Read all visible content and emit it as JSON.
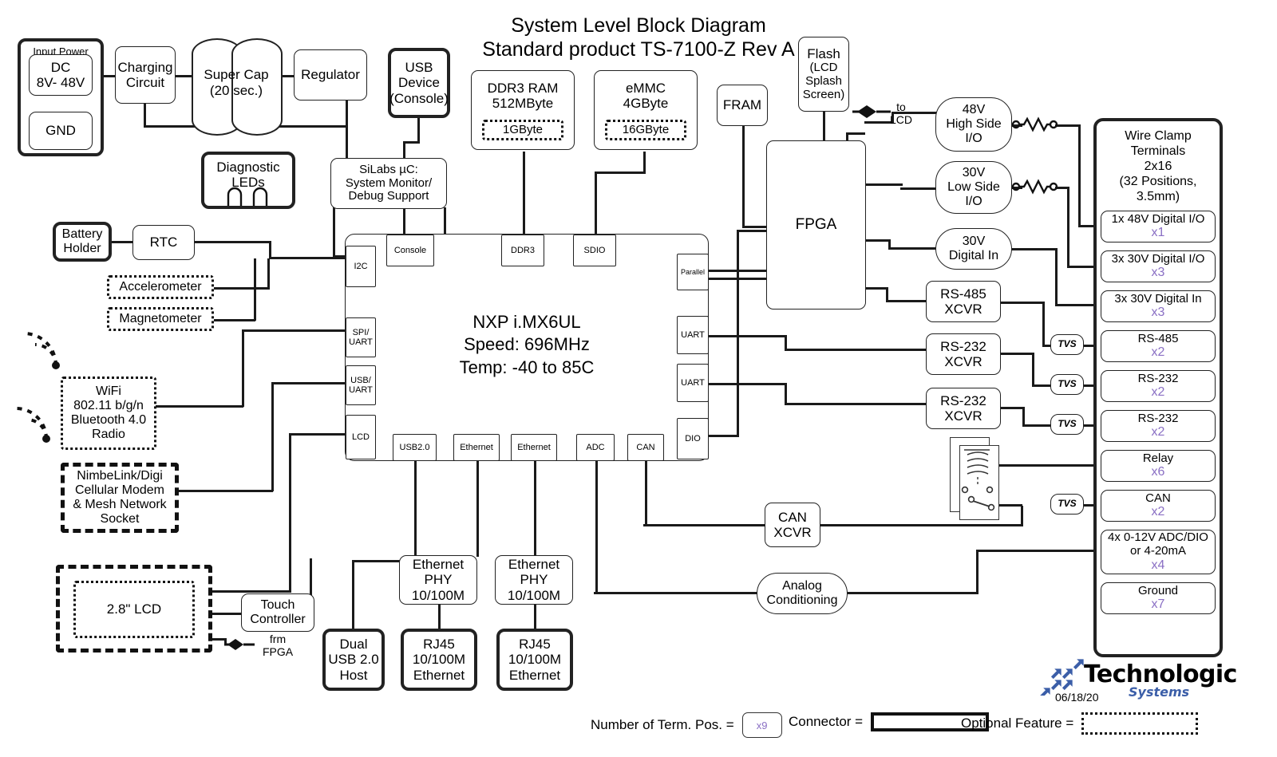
{
  "title": {
    "line1": "System Level Block Diagram",
    "line2": "Standard product TS-7100-Z Rev A"
  },
  "power": {
    "group_label": "Input Power",
    "dc": "DC\n8V- 48V",
    "dc_l1": "DC",
    "dc_l2": "8V- 48V",
    "gnd": "GND",
    "charging": "Charging\nCircuit",
    "charging_l1": "Charging",
    "charging_l2": "Circuit",
    "supercap_l1": "Super Cap",
    "supercap_l2": "(20 sec.)",
    "regulator": "Regulator"
  },
  "usb_device": {
    "l1": "USB",
    "l2": "Device",
    "l3": "(Console)"
  },
  "memory": {
    "ddr3_l1": "DDR3 RAM",
    "ddr3_l2": "512MByte",
    "ddr3_option": "1GByte",
    "emmc_l1": "eMMC",
    "emmc_l2": "4GByte",
    "emmc_option": "16GByte",
    "fram": "FRAM"
  },
  "flash": {
    "l1": "Flash",
    "l2": "(LCD",
    "l3": "Splash",
    "l4": "Screen)"
  },
  "fpga": {
    "label": "FPGA",
    "to_lcd_l1": "to",
    "to_lcd_l2": "LCD"
  },
  "silabs": {
    "l1": "SiLabs µC:",
    "l2": "System Monitor/",
    "l3": "Debug Support"
  },
  "diagnostic_leds": {
    "l1": "Diagnostic",
    "l2": "LEDs"
  },
  "left_peripherals": {
    "battery_l1": "Battery",
    "battery_l2": "Holder",
    "rtc": "RTC",
    "accelerometer": "Accelerometer",
    "magnetometer": "Magnetometer",
    "wifi_l1": "WiFi",
    "wifi_l2": "802.11 b/g/n",
    "wifi_l3": "Bluetooth 4.0",
    "wifi_l4": "Radio",
    "modem_l1": "NimbeLink/Digi",
    "modem_l2": "Cellular Modem",
    "modem_l3": "& Mesh Network",
    "modem_l4": "Socket",
    "lcd": "2.8\" LCD",
    "touch_l1": "Touch",
    "touch_l2": "Controller",
    "frm_fpga_l1": "frm",
    "frm_fpga_l2": "FPGA"
  },
  "cpu": {
    "name": "NXP i.MX6UL",
    "speed": "Speed: 696MHz",
    "temp": "Temp: -40 to 85C",
    "ports_top": [
      "Console",
      "DDR3",
      "SDIO"
    ],
    "ports_left": [
      "I2C",
      "SPI/\nUART",
      "USB/\nUART",
      "LCD"
    ],
    "ports_left_flat": [
      "I2C",
      "SPI/ UART",
      "USB/ UART",
      "LCD"
    ],
    "ports_right": [
      "Parallel",
      "UART",
      "UART",
      "DIO"
    ],
    "ports_bottom": [
      "USB2.0",
      "Ethernet",
      "Ethernet",
      "ADC",
      "CAN"
    ]
  },
  "bottom_blocks": {
    "eth_phy_l1": "Ethernet",
    "eth_phy_l2": "PHY",
    "eth_phy_l3": "10/100M",
    "rj45_l1": "RJ45",
    "rj45_l2": "10/100M",
    "rj45_l3": "Ethernet",
    "usb_host_l1": "Dual",
    "usb_host_l2": "USB 2.0",
    "usb_host_l3": "Host",
    "can_xcvr_l1": "CAN",
    "can_xcvr_l2": "XCVR",
    "analog_l1": "Analog",
    "analog_l2": "Conditioning"
  },
  "io_column": [
    {
      "l1": "48V",
      "l2": "High Side",
      "l3": "I/O",
      "shape": "pill"
    },
    {
      "l1": "30V",
      "l2": "Low Side",
      "l3": "I/O",
      "shape": "pill"
    },
    {
      "l1": "30V",
      "l2": "Digital In",
      "l3": "",
      "shape": "pill"
    },
    {
      "l1": "RS-485",
      "l2": "XCVR",
      "l3": "",
      "shape": "rect"
    },
    {
      "l1": "RS-232",
      "l2": "XCVR",
      "l3": "",
      "shape": "rect"
    },
    {
      "l1": "RS-232",
      "l2": "XCVR",
      "l3": "",
      "shape": "rect"
    }
  ],
  "tvs_label": "TVS",
  "terminals": {
    "header_l1": "Wire Clamp",
    "header_l2": "Terminals",
    "header_l3": "2x16",
    "header_l4": "(32 Positions,",
    "header_l5": "3.5mm)",
    "rows": [
      {
        "label": "1x 48V Digital I/O",
        "count": "x1"
      },
      {
        "label": "3x 30V Digital I/O",
        "count": "x3"
      },
      {
        "label": "3x 30V Digital In",
        "count": "x3"
      },
      {
        "label": "RS-485",
        "count": "x2"
      },
      {
        "label": "RS-232",
        "count": "x2"
      },
      {
        "label": "RS-232",
        "count": "x2"
      },
      {
        "label": "Relay",
        "count": "x6"
      },
      {
        "label": "CAN",
        "count": "x2"
      },
      {
        "label": "4x 0-12V ADC/DIO\nor 4-20mA",
        "count": "x4",
        "label_l1": "4x 0-12V ADC/DIO",
        "label_l2": "or 4-20mA"
      },
      {
        "label": "Ground",
        "count": "x7"
      }
    ]
  },
  "legend": {
    "term_pos_label": "Number of Term. Pos. =",
    "term_pos_sample": "x9",
    "connector_label": "Connector =",
    "optional_label": "Optional Feature ="
  },
  "logo": {
    "name": "Technologic",
    "sub": "Systems",
    "date": "06/18/20"
  },
  "colors": {
    "count_purple": "#8a6fc4",
    "logo_blue": "#3b5ea8",
    "line": "#1a1a1a"
  }
}
